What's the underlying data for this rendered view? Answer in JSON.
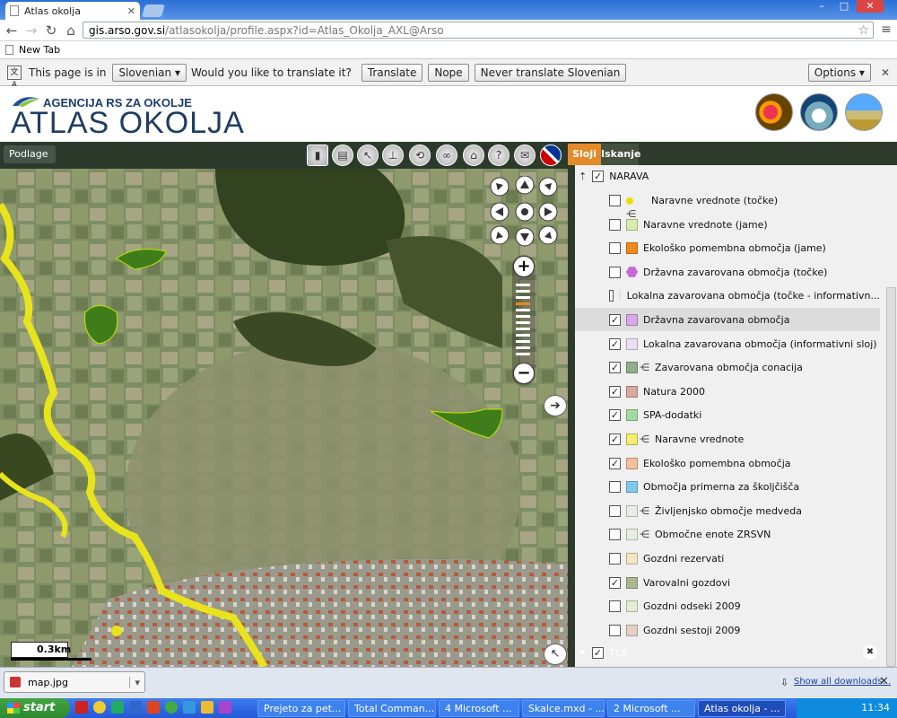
{
  "browser": {
    "tab_title": "Atlas okolja",
    "url_domain": "gis.arso.gov.si",
    "url_path": "/atlasokolja/profile.aspx?id=Atlas_Okolja_AXL@Arso",
    "bookmark": "New Tab",
    "window_buttons": [
      "–",
      "□",
      "✕"
    ]
  },
  "translate": {
    "prefix": "This page is in",
    "language": "Slovenian",
    "question": "Would you like to translate it?",
    "translate_btn": "Translate",
    "nope_btn": "Nope",
    "never_btn": "Never translate Slovenian",
    "options_btn": "Options"
  },
  "header": {
    "agency": "AGENCIJA RS ZA OKOLJE",
    "title": "ATLAS OKOLJA"
  },
  "map": {
    "base_menu": "Podlage",
    "scale": "0.3km"
  },
  "sidebar": {
    "tabs": [
      "Sloji",
      "Iskanje"
    ],
    "group_top": "NARAVA",
    "group_bottom": "TLA",
    "layers": [
      {
        "label": "Naravne vrednote (točke)",
        "checked": false,
        "color": "#e8e000",
        "icon": "dot-branch-icon"
      },
      {
        "label": "Naravne vrednote (jame)",
        "checked": false,
        "color": "#d8ecb0",
        "icon": "square-icon"
      },
      {
        "label": "Ekološko pomembna območja (jame)",
        "checked": false,
        "color": "#f08a1c",
        "icon": "square-icon"
      },
      {
        "label": "Državna zavarovana območja (točke)",
        "checked": false,
        "color": "#c66bd6",
        "icon": "hexagon-icon"
      },
      {
        "label": "Lokalna zavarovana območja (točke - informativn...",
        "checked": false,
        "color": "#e6dcf2",
        "icon": "hexagon-icon"
      },
      {
        "label": "Državna zavarovana območja",
        "checked": true,
        "color": "#d9a8e6",
        "icon": "square-icon"
      },
      {
        "label": "Lokalna zavarovana območja (informativni sloj)",
        "checked": true,
        "color": "#ece0f4",
        "icon": "square-icon"
      },
      {
        "label": "Zavarovana območja conacija",
        "checked": true,
        "color": "#8fae8a",
        "icon": "square-branch-icon"
      },
      {
        "label": "Natura 2000",
        "checked": true,
        "color": "#d8a8a2",
        "icon": "square-icon"
      },
      {
        "label": "SPA-dodatki",
        "checked": true,
        "color": "#a4dca0",
        "icon": "square-icon"
      },
      {
        "label": "Naravne vrednote",
        "checked": true,
        "color": "#f2ec70",
        "icon": "square-branch-icon"
      },
      {
        "label": "Ekološko pomembna območja",
        "checked": true,
        "color": "#f2c09a",
        "icon": "square-icon"
      },
      {
        "label": "Območja primerna za školjčišča",
        "checked": false,
        "color": "#80c8f0",
        "icon": "square-icon"
      },
      {
        "label": "Življenjsko območje medveda",
        "checked": false,
        "color": "#e6eee6",
        "icon": "square-branch-icon"
      },
      {
        "label": "Območne enote ZRSVN",
        "checked": false,
        "color": "#e6f0e0",
        "icon": "square-branch-icon"
      },
      {
        "label": "Gozdni rezervati",
        "checked": false,
        "color": "#f4e6c4",
        "icon": "square-icon"
      },
      {
        "label": "Varovalni gozdovi",
        "checked": true,
        "color": "#a8b892",
        "icon": "square-icon"
      },
      {
        "label": "Gozdni odseki 2009",
        "checked": false,
        "color": "#e6ecd2",
        "icon": "square-icon"
      },
      {
        "label": "Gozdni sestoji 2009",
        "checked": false,
        "color": "#e6d0c6",
        "icon": "square-icon"
      }
    ],
    "highlighted_index": 5
  },
  "downloads": {
    "file": "map.jpg",
    "show_all": "Show all downloads..."
  },
  "taskbar": {
    "start": "start",
    "tasks": [
      "Prejeto za pet...",
      "Total Comman...",
      "4 Microsoft ...",
      "Skalce.mxd - ...",
      "2 Microsoft ...",
      "Atlas okolja - ..."
    ],
    "clock": "11:34"
  }
}
